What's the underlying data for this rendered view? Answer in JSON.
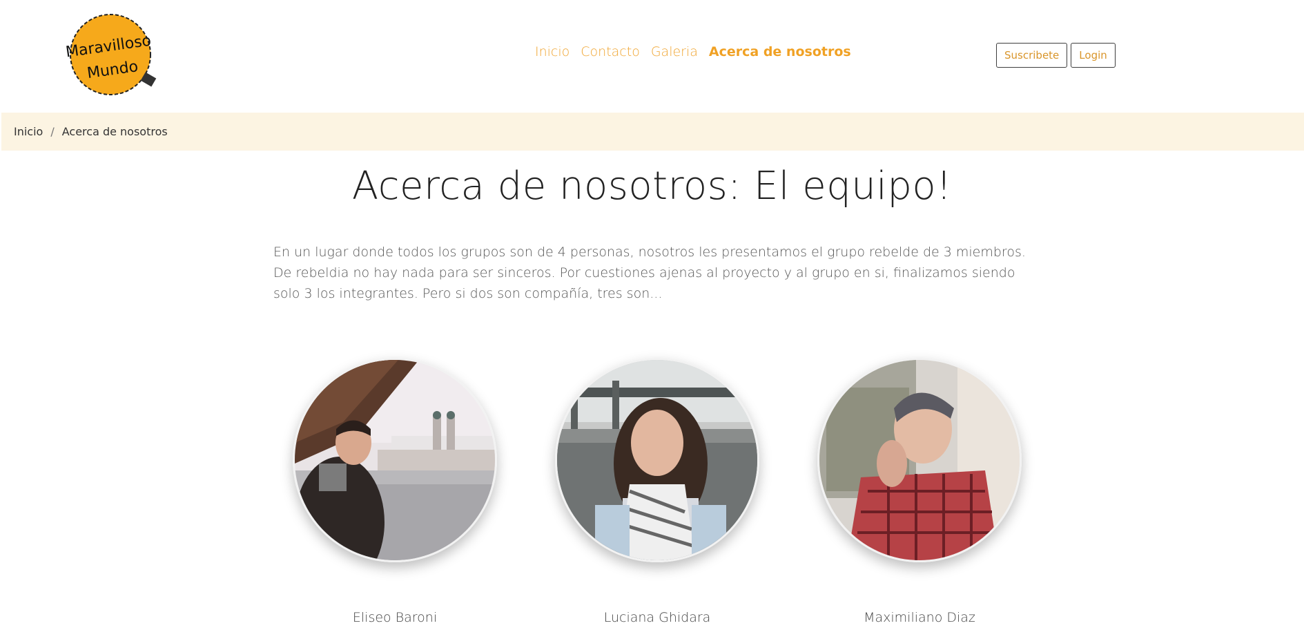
{
  "logo": {
    "line1": "Maravilloso",
    "line2": "Mundo",
    "color": "#f6a91b"
  },
  "nav": {
    "items": [
      {
        "label": "Inicio"
      },
      {
        "label": "Contacto"
      },
      {
        "label": "Galeria"
      },
      {
        "label": "Acerca de nosotros"
      }
    ]
  },
  "auth": {
    "subscribe": "Suscribete",
    "login": "Login"
  },
  "breadcrumb": {
    "home": "Inicio",
    "separator": "/",
    "current": "Acerca de nosotros"
  },
  "page": {
    "title": "Acerca de nosotros: El equipo!",
    "intro": "En un lugar donde todos los grupos son de 4 personas, nosotros les presentamos el grupo rebelde de 3 miembros. De rebeldia no hay nada para ser sinceros. Por cuestiones ajenas al proyecto y al grupo en si, finalizamos siendo solo 3 los integrantes. Pero si dos son compañía, tres son..."
  },
  "team": [
    {
      "name": "Eliseo Baroni"
    },
    {
      "name": "Luciana Ghidara"
    },
    {
      "name": "Maximiliano Diaz"
    }
  ],
  "colors": {
    "accent": "#f0a531",
    "breadcrumb_bg": "#fcf4e2"
  }
}
